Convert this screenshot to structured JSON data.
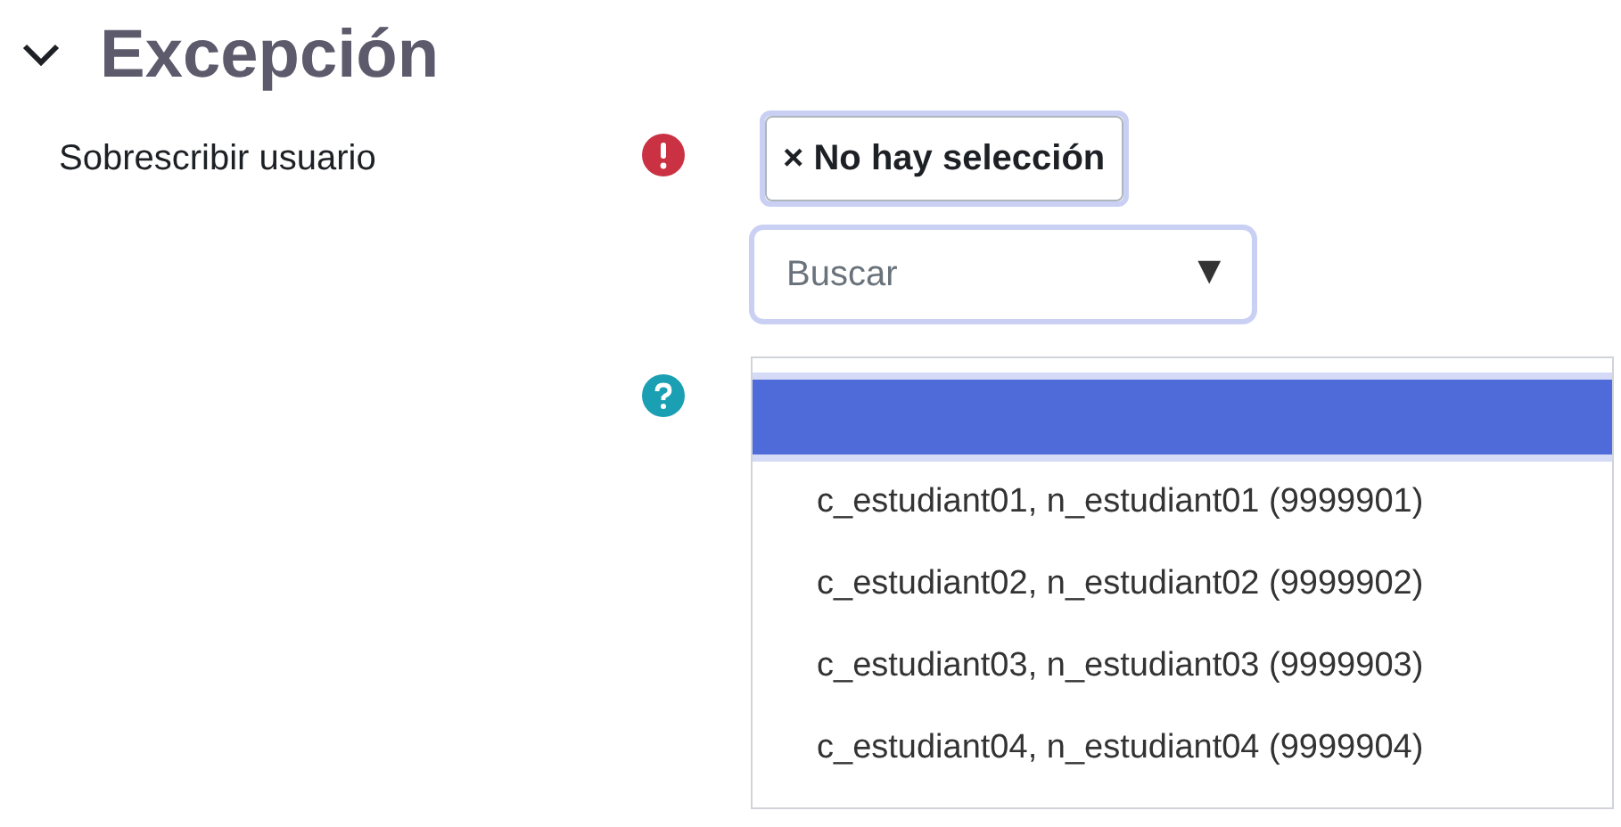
{
  "section": {
    "title": "Excepción",
    "expanded": true
  },
  "fields": [
    {
      "label": "Sobrescribir usuario",
      "kind": "error"
    },
    {
      "kind": "help"
    }
  ],
  "selection": {
    "chip": "× No hay selección"
  },
  "search": {
    "placeholder": "Buscar",
    "caret": "▼"
  },
  "options": [
    {
      "selected": true
    },
    {
      "label": "c_estudiant01, n_estudiant01 (9999901)",
      "selected": false
    },
    {
      "label": "c_estudiant02, n_estudiant02 (9999902)",
      "selected": false
    },
    {
      "label": "c_estudiant03, n_estudiant03 (9999903)",
      "selected": false
    },
    {
      "label": "c_estudiant04, n_estudiant04 (9999904)",
      "selected": false
    }
  ]
}
